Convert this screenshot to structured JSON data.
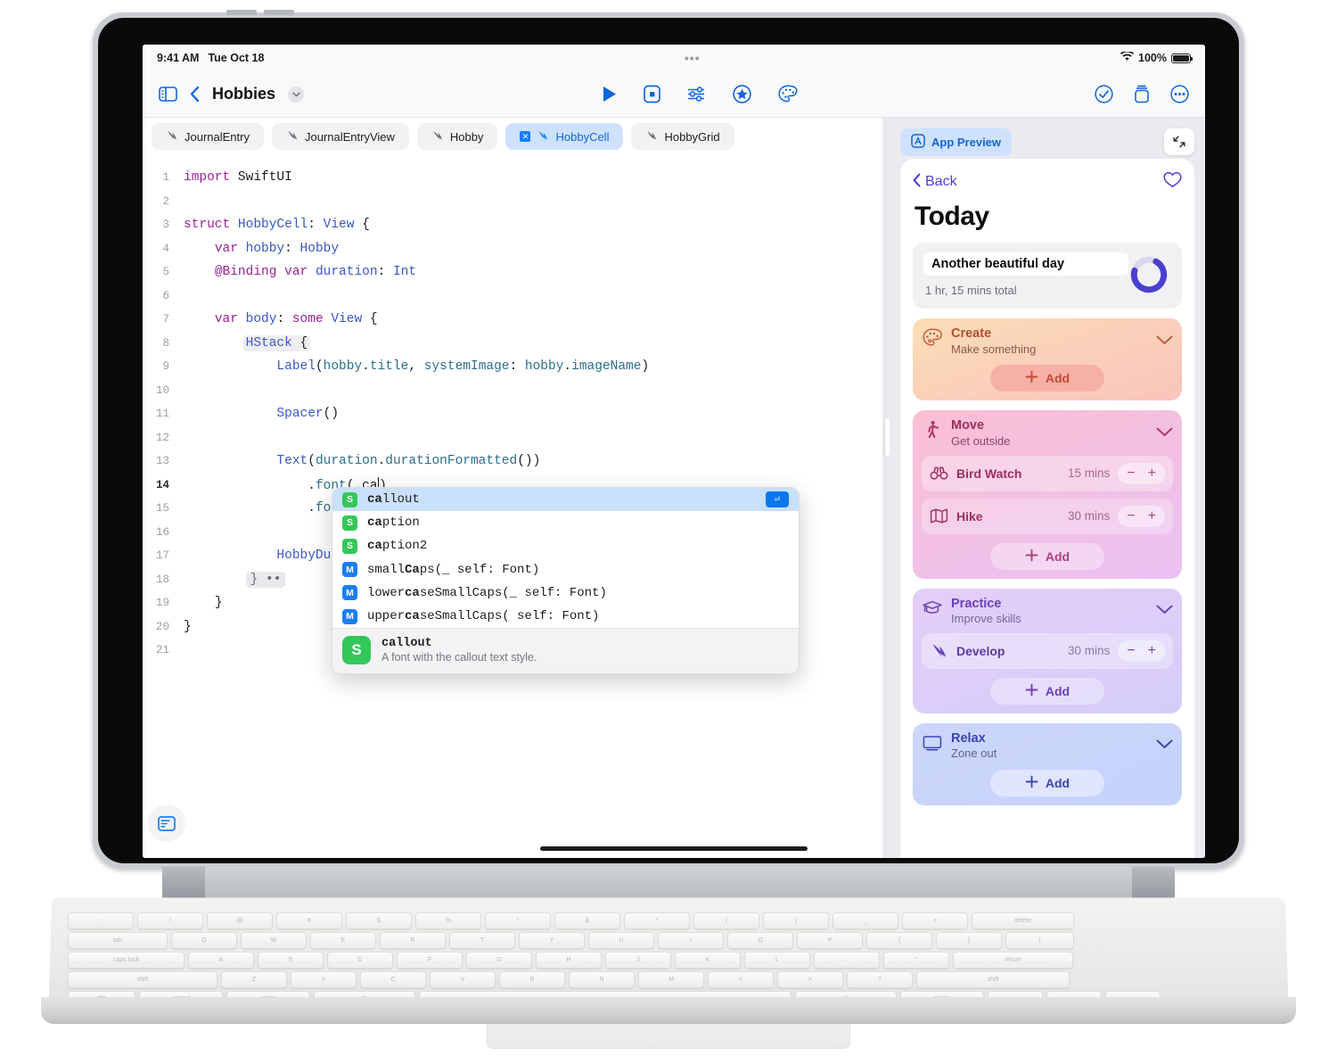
{
  "status_bar": {
    "time": "9:41 AM",
    "date": "Tue Oct 18",
    "battery_percent": "100%",
    "wifi_icon": "wifi-icon",
    "multitask_icon": "multitask-dots-icon"
  },
  "toolbar": {
    "sidebar_icon": "sidebar-toggle-icon",
    "back_icon": "chevron-left-icon",
    "title": "Hobbies",
    "title_chevron_icon": "chevron-down-icon",
    "center_actions": [
      {
        "name": "run-button",
        "icon": "play-icon"
      },
      {
        "name": "stop-button",
        "icon": "stop-square-icon"
      },
      {
        "name": "settings-button",
        "icon": "sliders-icon"
      },
      {
        "name": "favorites-button",
        "icon": "star-circle-icon"
      },
      {
        "name": "appearance-button",
        "icon": "palette-icon"
      }
    ],
    "right_actions": [
      {
        "name": "issues-button",
        "icon": "checkmark-circle-icon"
      },
      {
        "name": "library-button",
        "icon": "library-icon"
      },
      {
        "name": "more-button",
        "icon": "ellipsis-circle-icon"
      }
    ]
  },
  "tabs": [
    {
      "label": "JournalEntry",
      "active": false,
      "icon": "swift-file-icon"
    },
    {
      "label": "JournalEntryView",
      "active": false,
      "icon": "swift-file-icon"
    },
    {
      "label": "Hobby",
      "active": false,
      "icon": "swift-file-icon"
    },
    {
      "label": "HobbyCell",
      "active": true,
      "icon": "swift-file-icon",
      "close_icon": "close-icon"
    },
    {
      "label": "HobbyGrid",
      "active": false,
      "icon": "swift-file-icon"
    }
  ],
  "editor": {
    "language": "swift",
    "console_icon": "console-icon",
    "current_line": "14",
    "lines": [
      {
        "n": "1",
        "text": "import SwiftUI"
      },
      {
        "n": "2",
        "text": ""
      },
      {
        "n": "3",
        "text": "struct HobbyCell: View {"
      },
      {
        "n": "4",
        "text": "    var hobby: Hobby"
      },
      {
        "n": "5",
        "text": "    @Binding var duration: Int"
      },
      {
        "n": "6",
        "text": ""
      },
      {
        "n": "7",
        "text": "    var body: some View {"
      },
      {
        "n": "8",
        "text": "        HStack {"
      },
      {
        "n": "9",
        "text": "            Label(hobby.title, systemImage: hobby.imageName)"
      },
      {
        "n": "10",
        "text": ""
      },
      {
        "n": "11",
        "text": "            Spacer()"
      },
      {
        "n": "12",
        "text": ""
      },
      {
        "n": "13",
        "text": "            Text(duration.durationFormatted())"
      },
      {
        "n": "14",
        "text": "                .font(.ca)"
      },
      {
        "n": "15",
        "text": "                .fo"
      },
      {
        "n": "16",
        "text": ""
      },
      {
        "n": "17",
        "text": "            HobbyDu"
      },
      {
        "n": "18",
        "text": "        } ••"
      },
      {
        "n": "19",
        "text": "    }"
      },
      {
        "n": "20",
        "text": "}"
      },
      {
        "n": "21",
        "text": ""
      }
    ]
  },
  "autocomplete": {
    "enter_icon": "return-key-icon",
    "items": [
      {
        "kind": "S",
        "prefix": "ca",
        "rest": "llout",
        "selected": true
      },
      {
        "kind": "S",
        "prefix": "ca",
        "rest": "ption",
        "selected": false
      },
      {
        "kind": "S",
        "prefix": "ca",
        "rest": "ption2",
        "selected": false
      },
      {
        "kind": "M",
        "prefix": "",
        "pre": "small",
        "bold": "Ca",
        "rest": "ps(_ self: Font)",
        "selected": false
      },
      {
        "kind": "M",
        "prefix": "",
        "pre": "lower",
        "bold": "ca",
        "rest": "seSmallCaps(_ self: Font)",
        "selected": false
      },
      {
        "kind": "M",
        "prefix": "",
        "pre": "upper",
        "bold": "ca",
        "rest": "seSmallCaps(_ self: Font)",
        "selected": false
      }
    ],
    "doc": {
      "kind": "S",
      "title": "callout",
      "description": "A font with the callout text style."
    }
  },
  "preview": {
    "chip_label": "App Preview",
    "chip_icon": "app-preview-icon",
    "expand_icon": "expand-diagonal-icon",
    "phone": {
      "back_label": "Back",
      "back_icon": "chevron-left-icon",
      "favorite_icon": "heart-icon",
      "title": "Today",
      "summary": {
        "note": "Another beautiful day",
        "total": "1 hr, 15 mins total",
        "ring_icon": "progress-ring",
        "ring_percent": 72,
        "ring_color": "#4b3fd0",
        "ring_track_color": "#d8d6ee"
      },
      "cards": [
        {
          "title": "Create",
          "subtitle": "Make something",
          "icon": "palette-icon",
          "chevron_icon": "chevron-down-icon",
          "accent": "#c0593a",
          "grad_from": "#fbddb6",
          "grad_to": "#f9c3bd",
          "pill_bg": "#f7b5ab",
          "add_label": "Add",
          "add_icon": "plus-icon",
          "items": []
        },
        {
          "title": "Move",
          "subtitle": "Get outside",
          "icon": "walk-icon",
          "chevron_icon": "chevron-down-icon",
          "accent": "#b03469",
          "grad_from": "#fbc0d4",
          "grad_to": "#e8c0f2",
          "pill_bg": "rgba(255,255,255,0.34)",
          "add_label": "Add",
          "add_icon": "plus-icon",
          "items": [
            {
              "name": "Bird Watch",
              "icon": "binoculars-icon",
              "mins": "15 mins",
              "minus_icon": "minus-icon",
              "plus_icon": "plus-icon"
            },
            {
              "name": "Hike",
              "icon": "map-icon",
              "mins": "30 mins",
              "minus_icon": "minus-icon",
              "plus_icon": "plus-icon"
            }
          ]
        },
        {
          "title": "Practice",
          "subtitle": "Improve skills",
          "icon": "graduation-cap-icon",
          "chevron_icon": "chevron-down-icon",
          "accent": "#6b41b8",
          "grad_from": "#e3cdf6",
          "grad_to": "#d6cdf8",
          "pill_bg": "rgba(255,255,255,0.34)",
          "add_label": "Add",
          "add_icon": "plus-icon",
          "items": [
            {
              "name": "Develop",
              "icon": "swift-icon",
              "mins": "30 mins",
              "minus_icon": "minus-icon",
              "plus_icon": "plus-icon"
            }
          ]
        },
        {
          "title": "Relax",
          "subtitle": "Zone out",
          "icon": "tv-icon",
          "chevron_icon": "chevron-down-icon",
          "accent": "#3c45b0",
          "grad_from": "#ccd6fa",
          "grad_to": "#c5d2fb",
          "pill_bg": "rgba(255,255,255,0.38)",
          "add_label": "Add",
          "add_icon": "plus-icon",
          "items": []
        }
      ]
    }
  },
  "colors": {
    "accent_blue": "#1066d6",
    "tab_active_bg": "#cfe2fd",
    "swift_orange": "#f05138",
    "badge_struct": "#34c759",
    "badge_method": "#1a7ef5"
  }
}
